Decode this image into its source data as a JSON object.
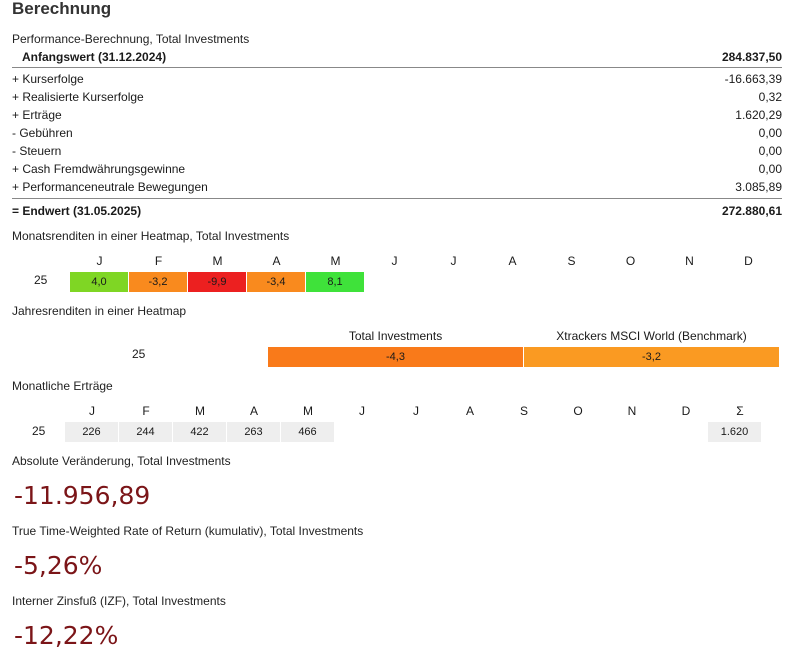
{
  "title": "Berechnung",
  "performance": {
    "label": "Performance-Berechnung, Total Investments",
    "start": {
      "label": "Anfangswert (31.12.2024)",
      "value": "284.837,50"
    },
    "rows": [
      {
        "label": "+ Kurserfolge",
        "value": "-16.663,39"
      },
      {
        "label": "+ Realisierte Kurserfolge",
        "value": "0,32"
      },
      {
        "label": "+ Erträge",
        "value": "1.620,29"
      },
      {
        "label": "-  Gebühren",
        "value": "0,00"
      },
      {
        "label": "-  Steuern",
        "value": "0,00"
      },
      {
        "label": "+ Cash Fremdwährungsgewinne",
        "value": "0,00"
      },
      {
        "label": "+ Performanceneutrale Bewegungen",
        "value": "3.085,89"
      }
    ],
    "end": {
      "label": "= Endwert (31.05.2025)",
      "value": "272.880,61"
    }
  },
  "monthly_heatmap": {
    "label": "Monatsrenditen in einer Heatmap, Total Investments",
    "months": [
      "J",
      "F",
      "M",
      "A",
      "M",
      "J",
      "J",
      "A",
      "S",
      "O",
      "N",
      "D"
    ],
    "year": "25",
    "values": [
      "4,0",
      "-3,2",
      "-9,9",
      "-3,4",
      "8,1"
    ],
    "colors": [
      "#7fd624",
      "#f98a1e",
      "#ec2020",
      "#f98a1e",
      "#3fe23a"
    ]
  },
  "yearly_heatmap": {
    "label": "Jahresrenditen in einer Heatmap",
    "year": "25",
    "columns": [
      "Total Investments",
      "Xtrackers MSCI World (Benchmark)"
    ],
    "values": [
      "-4,3",
      "-3,2"
    ],
    "colors": [
      "#f97a1a",
      "#fa9a22"
    ]
  },
  "monthly_earnings": {
    "label": "Monatliche Erträge",
    "months": [
      "J",
      "F",
      "M",
      "A",
      "M",
      "J",
      "J",
      "A",
      "S",
      "O",
      "N",
      "D",
      "Σ"
    ],
    "year": "25",
    "values": [
      "226",
      "244",
      "422",
      "263",
      "466"
    ],
    "total": "1.620"
  },
  "absolute_change": {
    "label": "Absolute Veränderung, Total Investments",
    "value": "-11.956,89"
  },
  "ttwror": {
    "label": "True Time-Weighted Rate of Return (kumulativ), Total Investments",
    "value": "-5,26%"
  },
  "irr": {
    "label": "Interner Zinsfuß (IZF), Total Investments",
    "value": "-12,22%"
  }
}
